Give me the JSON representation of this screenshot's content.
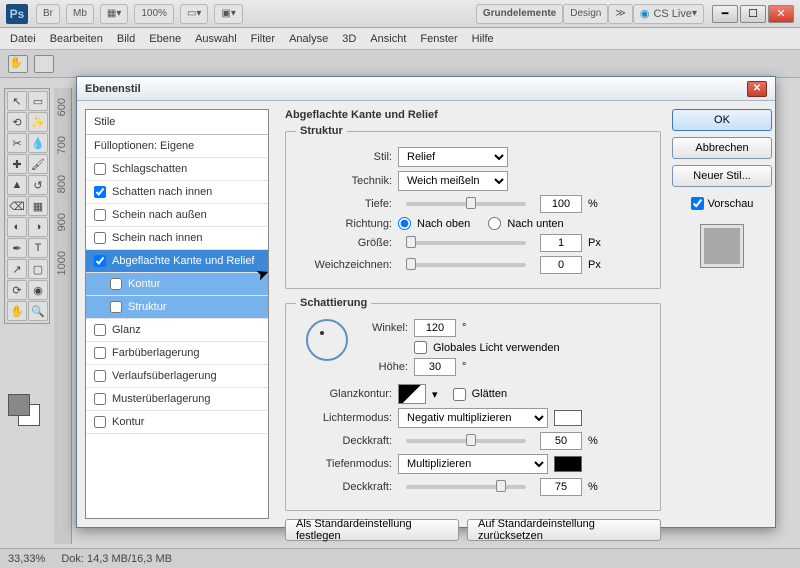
{
  "titlebar": {
    "tabs": [
      "Br",
      "Mb"
    ],
    "zoom": "100%",
    "grundelemente": "Grundelemente",
    "design": "Design",
    "cs": "CS Live"
  },
  "menu": [
    "Datei",
    "Bearbeiten",
    "Bild",
    "Ebene",
    "Auswahl",
    "Filter",
    "Analyse",
    "3D",
    "Ansicht",
    "Fenster",
    "Hilfe"
  ],
  "dialog": {
    "title": "Ebenenstil",
    "styles_header": "Stile",
    "fill_opts": "Fülloptionen: Eigene",
    "items": [
      {
        "label": "Schlagschatten",
        "chk": false
      },
      {
        "label": "Schatten nach innen",
        "chk": true
      },
      {
        "label": "Schein nach außen",
        "chk": false
      },
      {
        "label": "Schein nach innen",
        "chk": false
      },
      {
        "label": "Abgeflachte Kante und Relief",
        "chk": true,
        "sel": true
      },
      {
        "label": "Kontur",
        "sub": true
      },
      {
        "label": "Struktur",
        "sub": true
      },
      {
        "label": "Glanz",
        "chk": false
      },
      {
        "label": "Farbüberlagerung",
        "chk": false
      },
      {
        "label": "Verlaufsüberlagerung",
        "chk": false
      },
      {
        "label": "Musterüberlagerung",
        "chk": false
      },
      {
        "label": "Kontur",
        "chk": false
      }
    ],
    "panel_title": "Abgeflachte Kante und Relief",
    "struktur": {
      "legend": "Struktur",
      "stil_label": "Stil:",
      "stil_val": "Relief",
      "technik_label": "Technik:",
      "technik_val": "Weich meißeln",
      "tiefe_label": "Tiefe:",
      "tiefe_val": "100",
      "tiefe_unit": "%",
      "richtung_label": "Richtung:",
      "r_up": "Nach oben",
      "r_down": "Nach unten",
      "groesse_label": "Größe:",
      "groesse_val": "1",
      "groesse_unit": "Px",
      "weich_label": "Weichzeichnen:",
      "weich_val": "0",
      "weich_unit": "Px"
    },
    "schatt": {
      "legend": "Schattierung",
      "winkel_label": "Winkel:",
      "winkel_val": "120",
      "deg": "°",
      "global": "Globales Licht verwenden",
      "hoehe_label": "Höhe:",
      "hoehe_val": "30",
      "gk_label": "Glanzkontur:",
      "glaetten": "Glätten",
      "licht_label": "Lichtermodus:",
      "licht_val": "Negativ multiplizieren",
      "deck_label": "Deckkraft:",
      "deck1": "50",
      "deck_unit": "%",
      "tief_label": "Tiefenmodus:",
      "tief_val": "Multiplizieren",
      "deck2": "75"
    },
    "buttons": {
      "default": "Als Standardeinstellung festlegen",
      "reset": "Auf Standardeinstellung zurücksetzen",
      "ok": "OK",
      "cancel": "Abbrechen",
      "new": "Neuer Stil...",
      "preview": "Vorschau"
    }
  },
  "status": {
    "zoom": "33,33%",
    "doc": "Dok: 14,3 MB/16,3 MB"
  }
}
